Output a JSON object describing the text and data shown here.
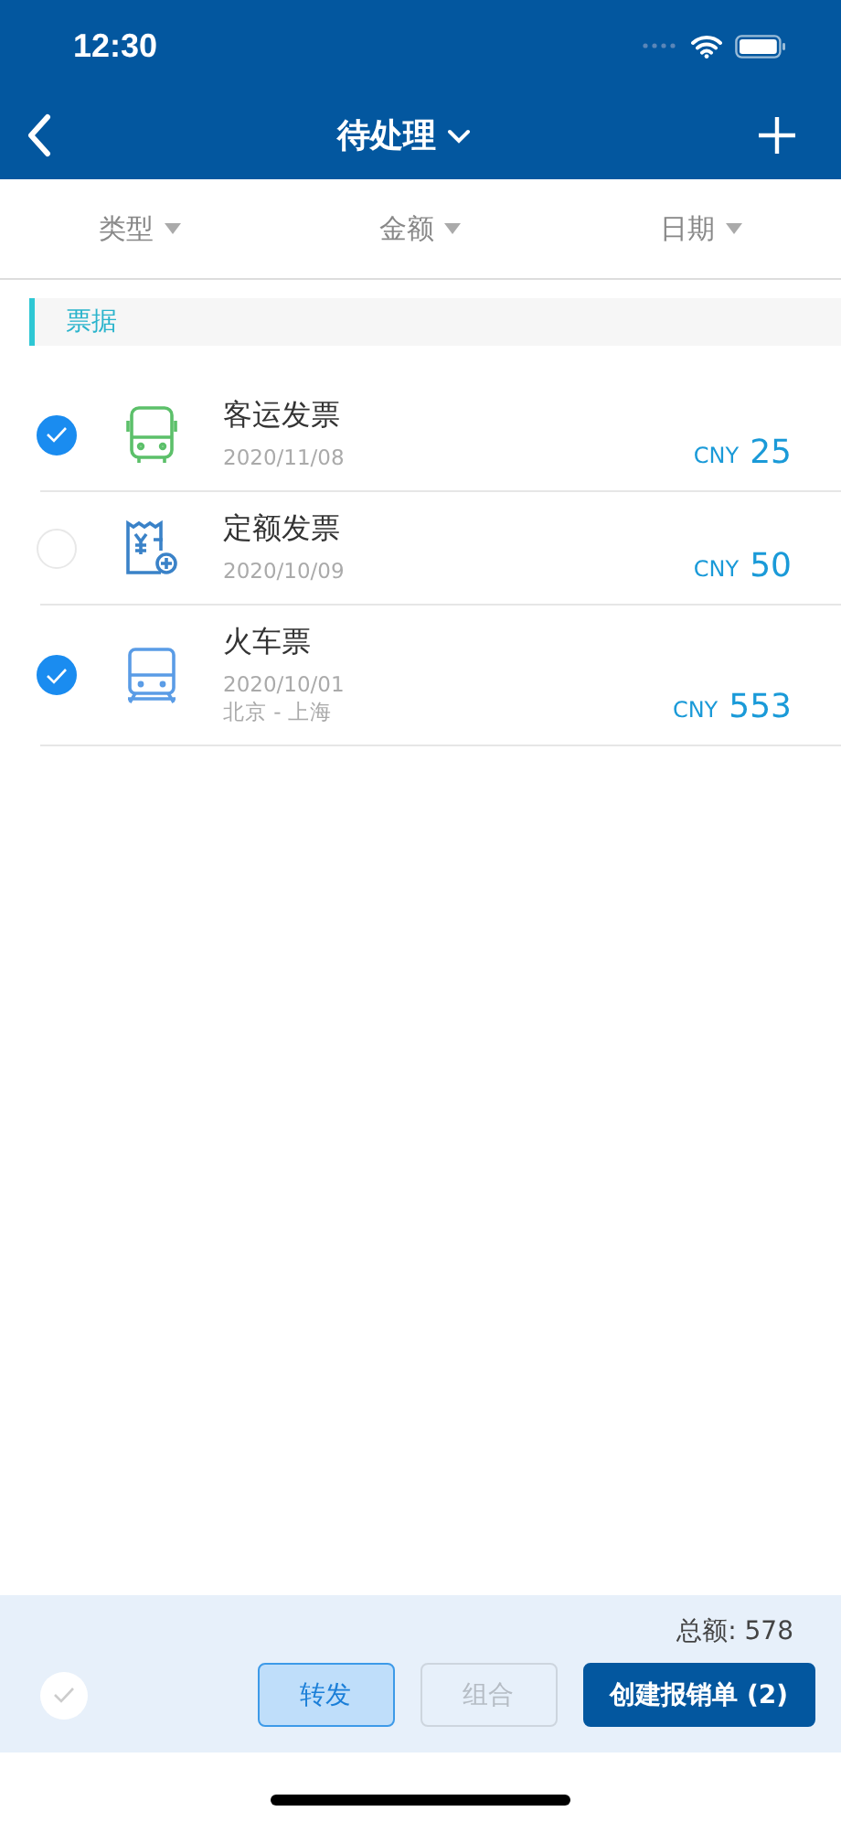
{
  "status_bar": {
    "time": "12:30"
  },
  "nav": {
    "title": "待处理"
  },
  "filters": [
    {
      "label": "类型"
    },
    {
      "label": "金额"
    },
    {
      "label": "日期"
    }
  ],
  "section": {
    "title": "票据"
  },
  "items": [
    {
      "kind": "bus",
      "title": "客运发票",
      "date": "2020/11/08",
      "currency": "CNY",
      "amount": "25",
      "checked": true
    },
    {
      "kind": "receipt",
      "title": "定额发票",
      "date": "2020/10/09",
      "currency": "CNY",
      "amount": "50",
      "checked": false
    },
    {
      "kind": "train",
      "title": "火车票",
      "date": "2020/10/01",
      "route": "北京 - 上海",
      "currency": "CNY",
      "amount": "553",
      "checked": true
    }
  ],
  "footer": {
    "total": "总额: 578",
    "select_all_checked": false,
    "buttons": [
      {
        "label": "转发",
        "kind": "secondary",
        "disabled": false
      },
      {
        "label": "组合",
        "kind": "secondary",
        "disabled": true
      },
      {
        "label": "创建报销单 (2)",
        "kind": "primary",
        "disabled": false
      }
    ]
  }
}
